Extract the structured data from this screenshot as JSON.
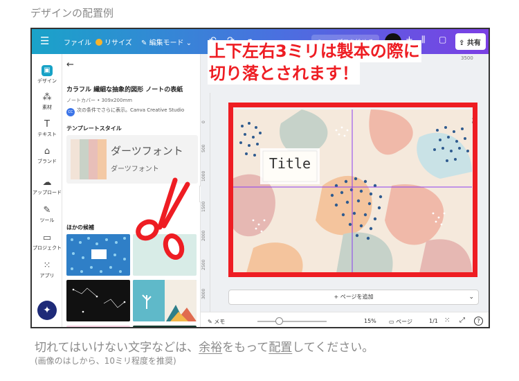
{
  "heading": "デザインの配置例",
  "topbar": {
    "file": "ファイル",
    "resize": "リサイズ",
    "edit_mode": "編集モード",
    "canva_pro": "Canvaプロを始める",
    "share": "共有"
  },
  "leftnav": {
    "items": [
      {
        "label": "デザイン",
        "icon": "design-icon"
      },
      {
        "label": "素材",
        "icon": "elements-icon"
      },
      {
        "label": "テキスト",
        "icon": "text-icon"
      },
      {
        "label": "ブランド",
        "icon": "brand-icon"
      },
      {
        "label": "アップロード",
        "icon": "upload-icon"
      },
      {
        "label": "ツール",
        "icon": "tools-icon"
      },
      {
        "label": "プロジェクト",
        "icon": "projects-icon"
      },
      {
        "label": "アプリ",
        "icon": "apps-icon"
      }
    ]
  },
  "panel": {
    "template_title": "カラフル 繊細な抽象的図形 ノートの表紙",
    "template_meta": "ノートカバー • 309x200mm",
    "author_initials": "CC",
    "author_text": "次の条件でさらに表示。Canva Creative Studio",
    "style_heading": "テンプレートスタイル",
    "font_sample_1": "ダーツフォント",
    "font_sample_2": "ダーツフォント",
    "swatch_colors": [
      "#f2e3d7",
      "#c9d2c7",
      "#e8bfb9",
      "#f3c9a5"
    ],
    "other_heading": "ほかの候補"
  },
  "editor": {
    "ruler_top": "3500",
    "ruler_marks": [
      "0",
      "500",
      "1000",
      "1500",
      "2000",
      "2500",
      "3000"
    ],
    "design_title": "Title",
    "add_page": "+ ページを追加"
  },
  "statusbar": {
    "memo": "メモ",
    "zoom": "15%",
    "pages": "ページ",
    "page_count": "1/1",
    "help": "?"
  },
  "callout": {
    "line1": "上下左右3ミリは製本の際に",
    "line2": "切り落とされます！",
    "color": "#ee1d23"
  },
  "note": {
    "main_before": "切れてはいけない文字などは、",
    "main_underlined": "余裕",
    "main_middle": "をもって",
    "main_underlined_2": "配置",
    "main_after": "してください。",
    "sub": "(画像のはしから、10ミリ程度を推奨)"
  }
}
